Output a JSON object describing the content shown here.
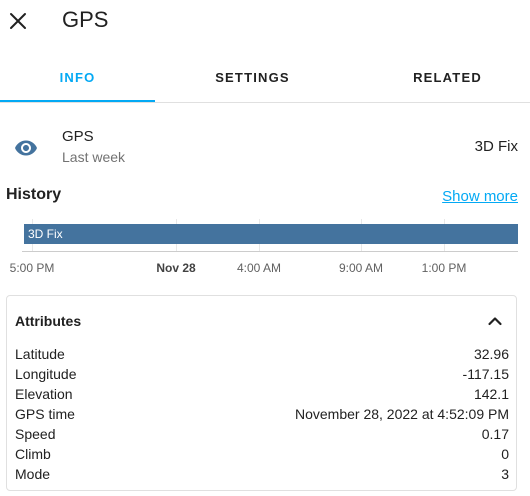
{
  "header": {
    "title": "GPS",
    "close_icon": "close-icon"
  },
  "tabs": [
    {
      "label": "INFO",
      "active": true
    },
    {
      "label": "SETTINGS",
      "active": false
    },
    {
      "label": "RELATED",
      "active": false
    }
  ],
  "entity": {
    "name": "GPS",
    "last_changed": "Last week",
    "state": "3D Fix",
    "icon": "eye-icon",
    "icon_color": "#44739e"
  },
  "history": {
    "title": "History",
    "show_more": "Show more",
    "bar_label": "3D Fix",
    "bar_color": "#44739e",
    "ticks": [
      {
        "label": "5:00 PM",
        "bold": false
      },
      {
        "label": "Nov 28",
        "bold": true
      },
      {
        "label": "4:00 AM",
        "bold": false
      },
      {
        "label": "9:00 AM",
        "bold": false
      },
      {
        "label": "1:00 PM",
        "bold": false
      }
    ]
  },
  "attributes": {
    "title": "Attributes",
    "rows": [
      {
        "key": "Latitude",
        "value": "32.96"
      },
      {
        "key": "Longitude",
        "value": "-117.15"
      },
      {
        "key": "Elevation",
        "value": "142.1"
      },
      {
        "key": "GPS time",
        "value": "November 28, 2022 at 4:52:09 PM"
      },
      {
        "key": "Speed",
        "value": "0.17"
      },
      {
        "key": "Climb",
        "value": "0"
      },
      {
        "key": "Mode",
        "value": "3"
      }
    ]
  },
  "colors": {
    "accent": "#03a9f4",
    "primary_text": "#212121",
    "secondary_text": "#727272"
  }
}
